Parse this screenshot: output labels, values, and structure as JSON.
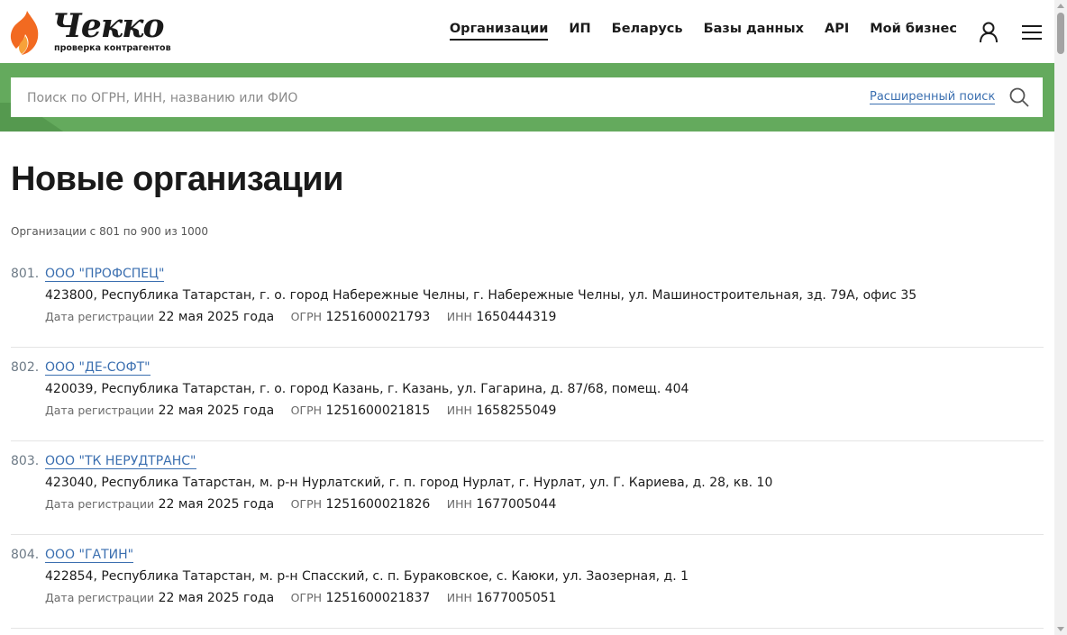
{
  "logo": {
    "word": "Чекко",
    "subtitle": "проверка контрагентов"
  },
  "nav": {
    "items": [
      {
        "label": "Организации",
        "active": true
      },
      {
        "label": "ИП"
      },
      {
        "label": "Беларусь"
      },
      {
        "label": "Базы данных"
      },
      {
        "label": "API"
      },
      {
        "label": "Мой бизнес"
      }
    ]
  },
  "search": {
    "placeholder": "Поиск по ОГРН, ИНН, названию или ФИО",
    "advanced_label": "Расширенный поиск"
  },
  "page": {
    "title": "Новые организации",
    "range": "Организации с 801 по 900 из 1000"
  },
  "labels": {
    "reg_date": "Дата регистрации",
    "ogrn": "ОГРН",
    "inn": "ИНН"
  },
  "organizations": [
    {
      "num": "801.",
      "name": "ООО \"ПРОФСПЕЦ\"",
      "address": "423800, Республика Татарстан, г. о. город Набережные Челны, г. Набережные Челны, ул. Машиностроительная, зд. 79А, офис 35",
      "reg_date": "22 мая 2025 года",
      "ogrn": "1251600021793",
      "inn": "1650444319"
    },
    {
      "num": "802.",
      "name": "ООО \"ДЕ-СОФТ\"",
      "address": "420039, Республика Татарстан, г. о. город Казань, г. Казань, ул. Гагарина, д. 87/68, помещ. 404",
      "reg_date": "22 мая 2025 года",
      "ogrn": "1251600021815",
      "inn": "1658255049"
    },
    {
      "num": "803.",
      "name": "ООО \"ТК НЕРУДТРАНС\"",
      "address": "423040, Республика Татарстан, м. р-н Нурлатский, г. п. город Нурлат, г. Нурлат, ул. Г. Кариева, д. 28, кв. 10",
      "reg_date": "22 мая 2025 года",
      "ogrn": "1251600021826",
      "inn": "1677005044"
    },
    {
      "num": "804.",
      "name": "ООО \"ГАТИН\"",
      "address": "422854, Республика Татарстан, м. р-н Спасский, с. п. Бураковское, с. Каюки, ул. Заозерная, д. 1",
      "reg_date": "22 мая 2025 года",
      "ogrn": "1251600021837",
      "inn": "1677005051"
    }
  ],
  "colors": {
    "brand_green": "#64aa5d",
    "link_blue": "#3b6fb0",
    "flame_orange": "#f26a21"
  },
  "icons": {
    "user": "user-icon",
    "menu": "menu-icon",
    "search": "search-icon",
    "logo": "flame-logo-icon"
  }
}
